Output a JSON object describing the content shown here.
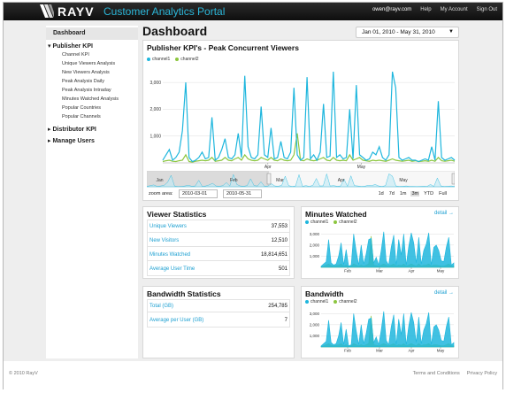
{
  "header": {
    "logo_text": "RAYV",
    "portal_title": "Customer Analytics Portal",
    "user_email": "owen@rayv.com",
    "links": [
      "Help",
      "My Account",
      "Sign Out"
    ]
  },
  "sidebar": {
    "dashboard_label": "Dashboard",
    "publisher": {
      "label": "Publisher KPI",
      "items": [
        "Channel KPI",
        "Unique Viewers Analysis",
        "New Viewers Analysis",
        "Peak Analysis Daily",
        "Peak Analysis Intraday",
        "Minutes Watched Analysis",
        "Popular Countries",
        "Popular Channels"
      ]
    },
    "distributor_label": "Distributor KPI",
    "manage_users_label": "Manage Users"
  },
  "page": {
    "title": "Dashboard",
    "date_range": "Jan 01, 2010 - May 31, 2010"
  },
  "colors": {
    "channel1": "#1eb6dd",
    "channel2": "#8cc63f",
    "link": "#1b9fd1"
  },
  "main_chart": {
    "title": "Publisher KPI's - Peak Concurrent Viewers",
    "legend": [
      "channel1",
      "channel2"
    ],
    "navigator_labels": [
      "Jan",
      "Feb",
      "Mar",
      "Apr",
      "May"
    ],
    "zoom": {
      "label": "zoom area:",
      "from": "2010-03-01",
      "to": "2010-05-31",
      "buttons": [
        "1d",
        "7d",
        "1m",
        "3m",
        "YTD",
        "Full"
      ],
      "active": "3m"
    }
  },
  "chart_data": [
    {
      "type": "line",
      "title": "Publisher KPI's - Peak Concurrent Viewers",
      "ylim": [
        0,
        3500
      ],
      "y_ticks": [
        "1,000",
        "2,000",
        "3,000"
      ],
      "x_tick_labels": [
        "Apr",
        "May"
      ],
      "series": [
        {
          "name": "channel1",
          "values": [
            100,
            300,
            500,
            100,
            200,
            400,
            1200,
            3000,
            200,
            50,
            100,
            200,
            400,
            150,
            200,
            1700,
            100,
            200,
            500,
            900,
            200,
            150,
            300,
            1100,
            200,
            3250,
            600,
            200,
            150,
            300,
            2100,
            300,
            200,
            1300,
            150,
            200,
            800,
            200,
            150,
            400,
            2800,
            300,
            100,
            200,
            3200,
            150,
            300,
            100,
            400,
            2200,
            200,
            250,
            3400,
            200,
            300,
            150,
            200,
            2000,
            150,
            2900,
            300,
            200,
            100,
            150,
            400,
            300,
            600,
            200,
            100,
            300,
            3400,
            2800,
            200,
            100,
            150,
            200,
            100,
            100,
            50,
            100,
            150,
            100,
            600,
            100,
            2300,
            200,
            100,
            150,
            200,
            100
          ]
        },
        {
          "name": "channel2",
          "values": [
            50,
            80,
            100,
            60,
            50,
            80,
            100,
            300,
            50,
            30,
            60,
            80,
            100,
            80,
            100,
            200,
            60,
            80,
            100,
            200,
            100,
            80,
            150,
            200,
            100,
            300,
            150,
            100,
            80,
            100,
            200,
            150,
            100,
            200,
            100,
            80,
            150,
            100,
            80,
            100,
            300,
            1100,
            100,
            80,
            150,
            100,
            80,
            100,
            150,
            200,
            100,
            80,
            200,
            100,
            80,
            100,
            80,
            300,
            100,
            150,
            200,
            100,
            80,
            60,
            100,
            80,
            100,
            80,
            60,
            100,
            150,
            100,
            80,
            60,
            80,
            100,
            60,
            80,
            50,
            60,
            80,
            60,
            100,
            60,
            200,
            80,
            60,
            80,
            100,
            60
          ]
        }
      ]
    },
    {
      "type": "area",
      "title": "Minutes Watched",
      "ylim": [
        0,
        3500
      ],
      "y_ticks": [
        "1,000",
        "2,000",
        "3,000"
      ],
      "x_tick_labels": [
        "Feb",
        "Mar",
        "Apr",
        "May"
      ],
      "series": [
        {
          "name": "channel1",
          "values": [
            100,
            300,
            500,
            2500,
            400,
            200,
            300,
            1000,
            2200,
            200,
            1600,
            100,
            200,
            3000,
            1500,
            200,
            2000,
            300,
            1200,
            2500,
            2600,
            400,
            900,
            200,
            1500,
            3200,
            600,
            200,
            1800,
            2900,
            200,
            2500,
            1100,
            3000,
            200,
            1900,
            3100,
            2200,
            400,
            2700,
            300,
            1500,
            2100,
            3100,
            200,
            1800,
            2000,
            1500,
            600,
            500,
            1800,
            2700,
            200,
            400
          ]
        },
        {
          "name": "channel2",
          "values": [
            50,
            100,
            200,
            300,
            150,
            100,
            150,
            200,
            300,
            100,
            200,
            80,
            100,
            300,
            200,
            100,
            200,
            100,
            200,
            300,
            2800,
            200,
            150,
            100,
            200,
            300,
            200,
            100,
            200,
            300,
            100,
            200,
            150,
            300,
            100,
            200,
            300,
            200,
            100,
            300,
            100,
            200,
            200,
            300,
            100,
            200,
            200,
            150,
            100,
            100,
            200,
            300,
            100,
            100
          ]
        }
      ]
    },
    {
      "type": "area",
      "title": "Bandwidth",
      "ylim": [
        0,
        3500
      ],
      "y_ticks": [
        "1,000",
        "2,000",
        "3,000"
      ],
      "x_tick_labels": [
        "Feb",
        "Mar",
        "Apr",
        "May"
      ],
      "series": [
        {
          "name": "channel1",
          "values": [
            100,
            300,
            500,
            2400,
            400,
            200,
            300,
            1000,
            2200,
            200,
            1600,
            100,
            200,
            3000,
            1500,
            200,
            2000,
            300,
            1200,
            2500,
            2600,
            400,
            900,
            200,
            1500,
            3200,
            600,
            200,
            1800,
            2900,
            200,
            2500,
            1100,
            3000,
            200,
            1900,
            3100,
            2200,
            400,
            2700,
            300,
            1500,
            2100,
            3100,
            200,
            1800,
            2000,
            1500,
            600,
            500,
            1800,
            2700,
            200,
            400
          ]
        },
        {
          "name": "channel2",
          "values": [
            50,
            100,
            200,
            300,
            150,
            100,
            150,
            200,
            300,
            100,
            200,
            80,
            100,
            300,
            200,
            100,
            200,
            100,
            200,
            300,
            2800,
            200,
            150,
            100,
            200,
            300,
            200,
            100,
            200,
            300,
            100,
            200,
            150,
            300,
            100,
            200,
            300,
            200,
            100,
            300,
            100,
            200,
            200,
            300,
            100,
            200,
            200,
            150,
            100,
            100,
            200,
            300,
            100,
            100
          ]
        }
      ]
    }
  ],
  "viewer_stats": {
    "title": "Viewer Statistics",
    "rows": [
      {
        "label": "Unique Viewers",
        "value": "37,553"
      },
      {
        "label": "New Visitors",
        "value": "12,510"
      },
      {
        "label": "Minutes Watched",
        "value": "18,814,651"
      },
      {
        "label": "Average User Time",
        "value": "501"
      }
    ]
  },
  "bandwidth_stats": {
    "title": "Bandwidth Statistics",
    "rows": [
      {
        "label": "Total (GB)",
        "value": "254,785"
      },
      {
        "label": "Average per User (GB)",
        "value": "7"
      }
    ]
  },
  "minutes_panel": {
    "title": "Minutes Watched",
    "detail": "detail →",
    "legend": [
      "channel1",
      "channel2"
    ]
  },
  "bandwidth_panel": {
    "title": "Bandwidth",
    "detail": "detail →",
    "legend": [
      "channel1",
      "channel2"
    ]
  },
  "footer": {
    "copyright": "© 2010 RayV",
    "links": [
      "Terms and Conditions",
      "Privacy Policy"
    ]
  }
}
